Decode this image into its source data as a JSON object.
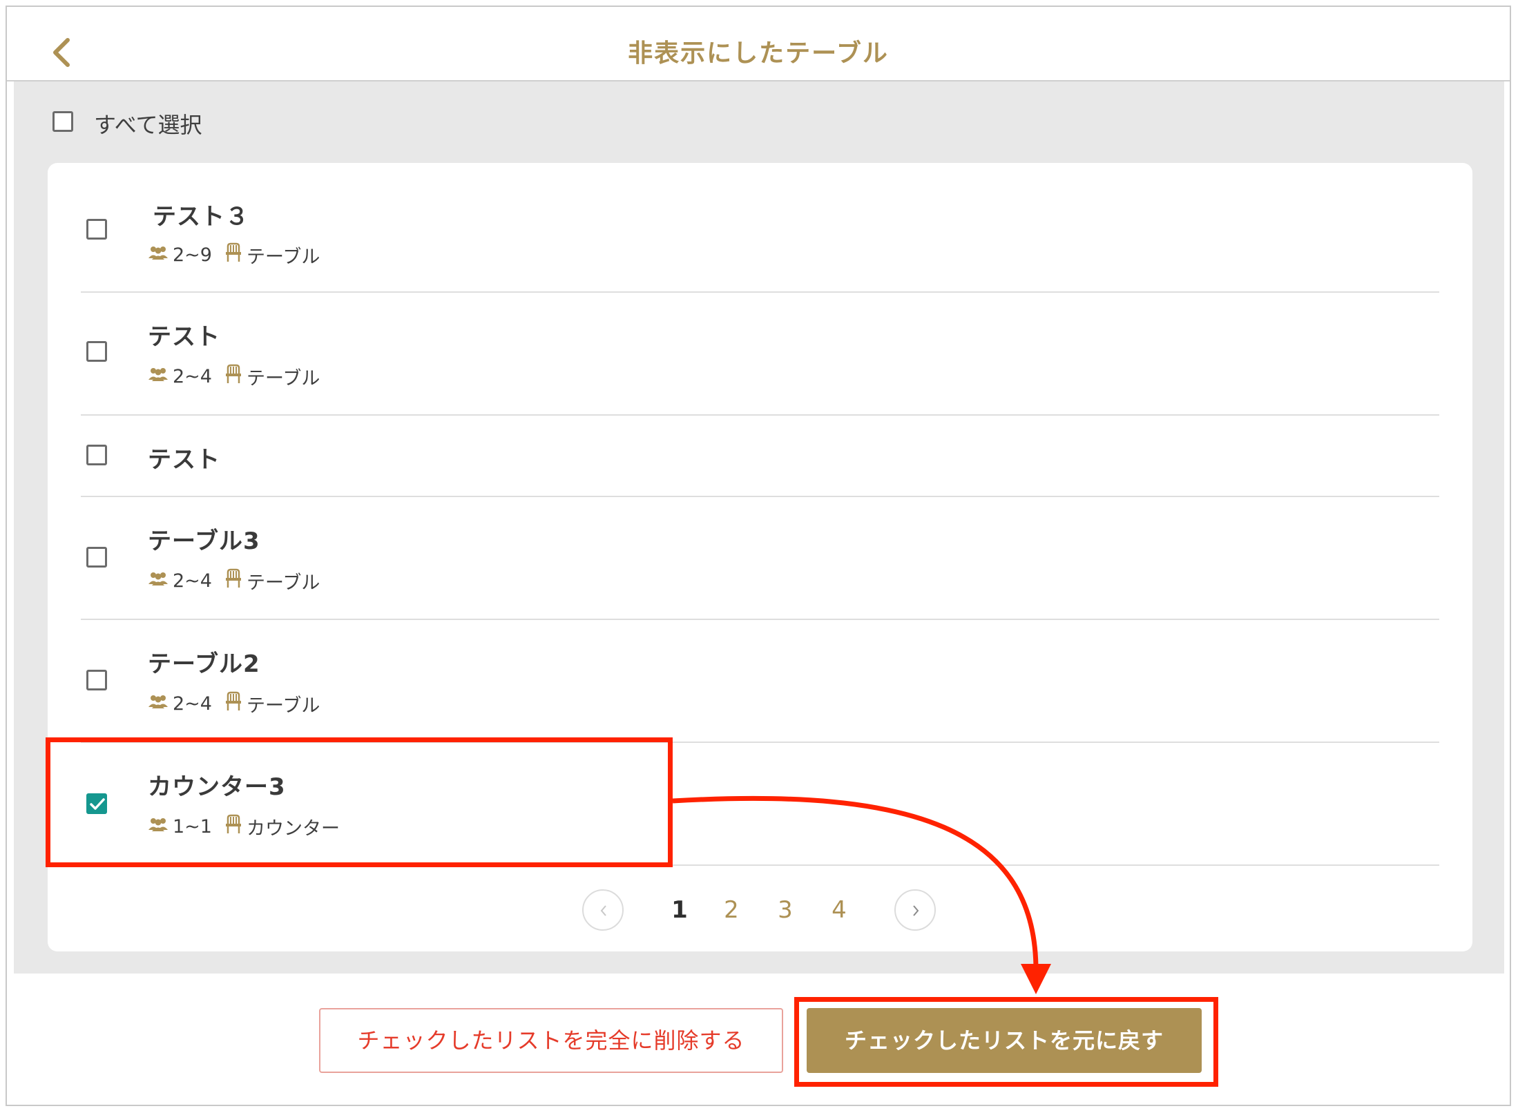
{
  "header": {
    "title": "非表示にしたテーブル"
  },
  "select_all": {
    "label": "すべて選択",
    "checked": false
  },
  "rows": [
    {
      "name": "テスト３",
      "capacity": "2~9",
      "type": "テーブル",
      "checked": false
    },
    {
      "name": "テスト",
      "capacity": "2~4",
      "type": "テーブル",
      "checked": false
    },
    {
      "name": "テスト",
      "capacity": "",
      "type": "",
      "checked": false
    },
    {
      "name": "テーブル3",
      "capacity": "2~4",
      "type": "テーブル",
      "checked": false
    },
    {
      "name": "テーブル2",
      "capacity": "2~4",
      "type": "テーブル",
      "checked": false
    },
    {
      "name": "カウンター3",
      "capacity": "1~1",
      "type": "カウンター",
      "checked": true
    }
  ],
  "pagination": {
    "pages": [
      "1",
      "2",
      "3",
      "4"
    ],
    "current": "1"
  },
  "actions": {
    "delete_label": "チェックしたリストを完全に削除する",
    "restore_label": "チェックしたリストを元に戻す"
  },
  "colors": {
    "accent": "#ad9154",
    "danger": "#e53b2a",
    "check": "#15978f",
    "annotation": "#ff2200"
  }
}
